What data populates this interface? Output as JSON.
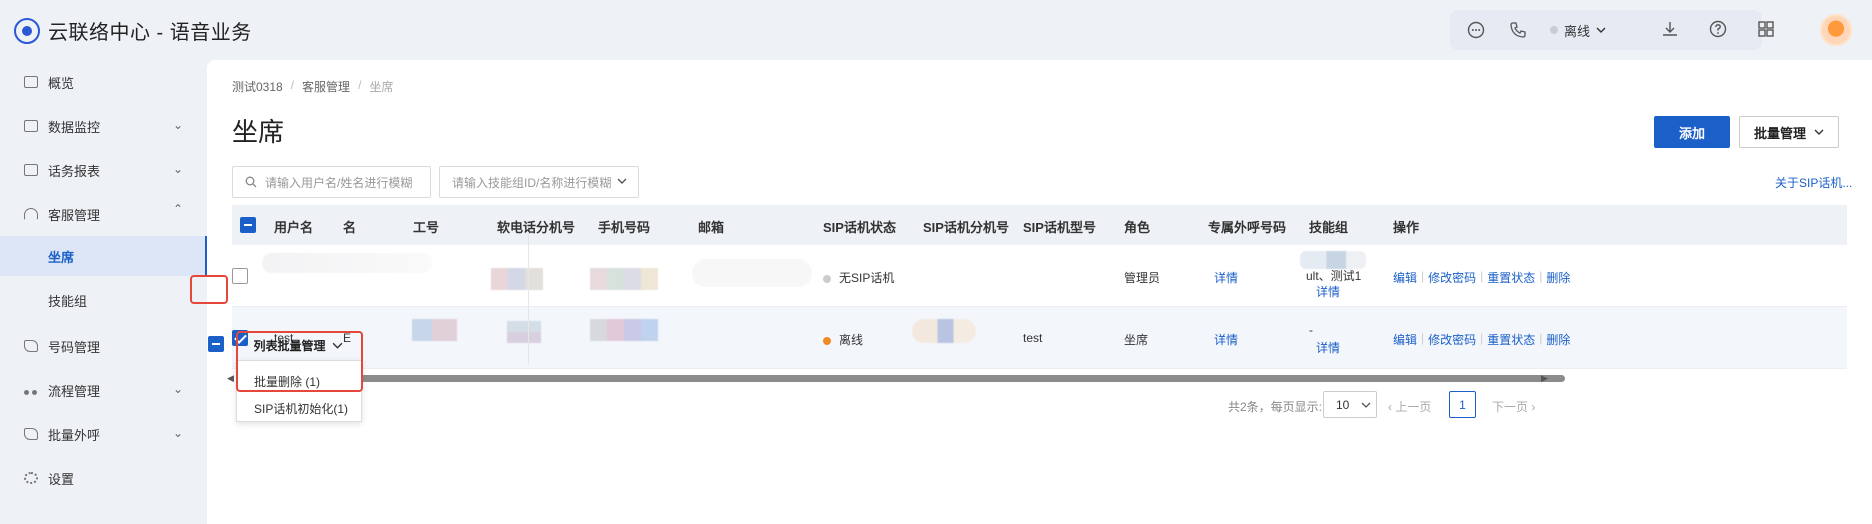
{
  "app": {
    "title": "云联络中心 - 语音业务"
  },
  "header": {
    "status_label": "离线",
    "icons": [
      "chat-icon",
      "phone-icon",
      "download-icon",
      "help-icon",
      "apps-icon"
    ]
  },
  "sidebar": {
    "items": [
      {
        "label": "概览"
      },
      {
        "label": "数据监控"
      },
      {
        "label": "话务报表"
      },
      {
        "label": "客服管理"
      },
      {
        "label": "号码管理"
      },
      {
        "label": "流程管理"
      },
      {
        "label": "批量外呼"
      },
      {
        "label": "设置"
      }
    ],
    "sub_items": [
      {
        "label": "坐席"
      },
      {
        "label": "技能组"
      }
    ]
  },
  "breadcrumb": {
    "root": "测试0318",
    "section": "客服管理",
    "current": "坐席"
  },
  "page": {
    "title": "坐席",
    "add_button": "添加",
    "batch_button": "批量管理",
    "search_user_placeholder": "请输入用户名/姓名进行模糊",
    "search_skill_placeholder": "请输入技能组ID/名称进行模糊",
    "sip_link": "关于SIP话机..."
  },
  "table": {
    "columns": [
      "用户名",
      "名",
      "工号",
      "软电话分机号",
      "手机号码",
      "邮箱",
      "SIP话机状态",
      "SIP话机分机号",
      "SIP话机型号",
      "角色",
      "专属外呼号码",
      "技能组",
      "操作"
    ],
    "rows": [
      {
        "username": "",
        "name": "",
        "sip_status": "无SIP话机",
        "sip_status_color": "#cccccc",
        "sip_model": "",
        "role": "管理员",
        "outbound": "详情",
        "skill_group": "ult、测试1",
        "skill_detail": "详情",
        "ops": [
          "编辑",
          "修改密码",
          "重置状态",
          "删除"
        ],
        "checked": false
      },
      {
        "username": "test",
        "name": "E",
        "sip_status": "离线",
        "sip_status_color": "#f08a24",
        "sip_model": "test",
        "role": "坐席",
        "outbound": "详情",
        "skill_group": "-",
        "skill_detail": "详情",
        "ops": [
          "编辑",
          "修改密码",
          "重置状态",
          "删除"
        ],
        "checked": true
      }
    ]
  },
  "footer": {
    "batch_label": "列表批量管理",
    "menu": [
      "批量删除 (1)",
      "SIP话机初始化(1)"
    ],
    "total_text": "共2条，每页显示:",
    "page_size": "10",
    "prev": "上一页",
    "current_page": "1",
    "next": "下一页"
  },
  "colors": {
    "primary": "#1b5fc9",
    "highlight": "#e5483a"
  }
}
